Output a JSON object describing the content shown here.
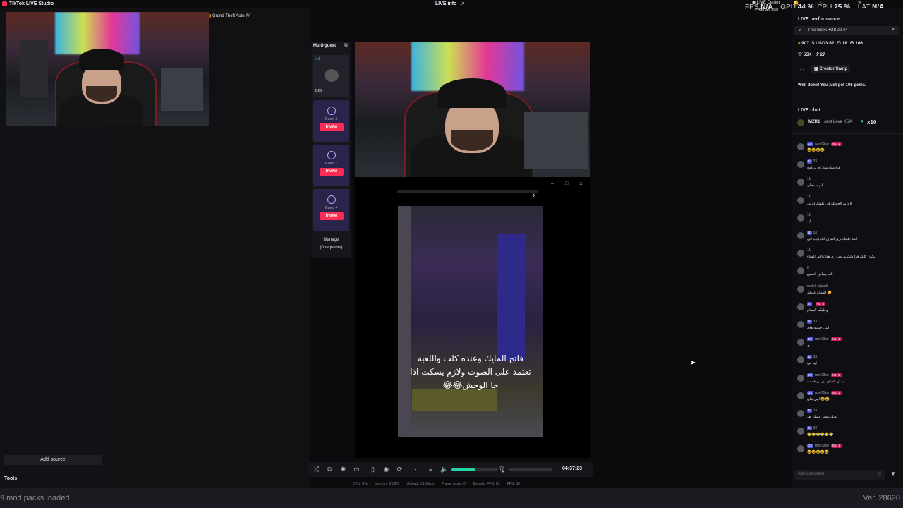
{
  "titlebar": {
    "app_title": "TikTok LIVE Studio",
    "center_title": "LIVE info",
    "live_center": "LIVE Center",
    "fps_label": "FPS",
    "fps_value": "N/A",
    "gpu_label": "GPU",
    "gpu_value": "44 %",
    "cpu_label": "CPU",
    "cpu_value": "25 %",
    "lat_label": "LAT",
    "lat_value": "N/A",
    "add_gift_goal": "Add Gift goal"
  },
  "scene": {
    "game_label": "Grand Theft Auto IV",
    "add_source": "Add source",
    "tools": "Tools"
  },
  "multiguest": {
    "title": "Multi-guest",
    "host_count": "0",
    "host_name": "DB9",
    "guests": [
      {
        "label": "Guest 2",
        "invite": "Invite"
      },
      {
        "label": "Guest 3",
        "invite": "Invite"
      },
      {
        "label": "Guest 4",
        "invite": "Invite"
      }
    ],
    "manage": "Manage",
    "requests": "(0 requests)"
  },
  "preview": {
    "caption": "فاتح المايك وعنده كلب واللعبه تعتمد على الصوت ولازم يسكت اذا جا الوحش😂😂"
  },
  "controls": {
    "timer": "04:37:23",
    "volume_level": 0.52,
    "stats": [
      "CPU: 0%",
      "Memory: 0.52%",
      "Upload: 8.1 Mbps",
      "Frame drops: 0",
      "Encoder FPS: 60",
      "FPS: 60"
    ]
  },
  "right": {
    "perf_title": "LIVE performance",
    "week_label": "This week +USD0.44",
    "stats": [
      {
        "icon": "diamond-icon",
        "value": "907"
      },
      {
        "icon": "dollar-icon",
        "value": "USD3.62"
      },
      {
        "icon": "people-icon",
        "value": "18"
      },
      {
        "icon": "viewers-icon",
        "value": "166"
      },
      {
        "icon": "heart-icon",
        "value": "55K"
      },
      {
        "icon": "share-icon",
        "value": "27"
      }
    ],
    "creator_camp": "Creator Camp",
    "well_done": "Well done! You just got 105 gems.",
    "chat_title": "LIVE chat",
    "gift_user": "MZR1",
    "gift_text": "sent Love KSA",
    "gift_count": "x10",
    "comment_placeholder": "Add comment",
    "messages": [
      {
        "badges": "22",
        "name": "roro73xo",
        "no1": "No. 1",
        "text": "😂😂😂😂"
      },
      {
        "badges": "8",
        "name": "33",
        "no1": "",
        "text": "قرا مثله مثل اي برنامج"
      },
      {
        "badges": "",
        "name": "11",
        "no1": "",
        "text": "ابو سمحان"
      },
      {
        "badges": "",
        "name": "11",
        "no1": "",
        "text": "لا دايم الحوقلة في كلهنك ايرني"
      },
      {
        "badges": "",
        "name": "11",
        "no1": "",
        "text": "ايه"
      },
      {
        "badges": "8",
        "name": "33",
        "no1": "",
        "text": "انتبه بكلبك ترى اسرق انك ذيب حي"
      },
      {
        "badges": "",
        "name": "11",
        "no1": "",
        "text": "يكون كلبك قرا ملكرين مب زي هذا كاليم اعضاء"
      },
      {
        "badges": "",
        "name": "0",
        "no1": "",
        "text": "الله يسامح الجميع"
      },
      {
        "badges": "",
        "name": "malek aljoudi",
        "no1": "",
        "text": "السلام عليكم 😘"
      },
      {
        "badges": "0",
        "name": "",
        "no1": "No. 3",
        "text": "وعليكم السلام"
      },
      {
        "badges": "8",
        "name": "33",
        "no1": "",
        "text": "ابيي حبيبيه هاي"
      },
      {
        "badges": "22",
        "name": "roro73xo",
        "no1": "No. 1",
        "text": "ي"
      },
      {
        "badges": "8",
        "name": "33",
        "no1": "",
        "text": "ابيا في"
      },
      {
        "badges": "22",
        "name": "roro73xo",
        "no1": "No. 1",
        "text": "يمكن عشان دي بي قست"
      },
      {
        "badges": "22",
        "name": "roro73xo",
        "no1": "No. 1",
        "text": "ابيي هاي 😂😂"
      },
      {
        "badges": "8",
        "name": "33",
        "no1": "",
        "text": "يديك تقصر عشك بعد"
      },
      {
        "badges": "8",
        "name": "33",
        "no1": "",
        "text": "😂😂😂😂😂😂"
      },
      {
        "badges": "22",
        "name": "roro73xo",
        "no1": "No. 1",
        "text": "😂😂😂😂😂"
      }
    ]
  },
  "statusbar": {
    "left": "9 mod packs loaded",
    "right": "Ver. 28620"
  },
  "colors": {
    "accent": "#fe2c55",
    "guest_card": "#2a234a",
    "volume": "#27d1a8"
  }
}
